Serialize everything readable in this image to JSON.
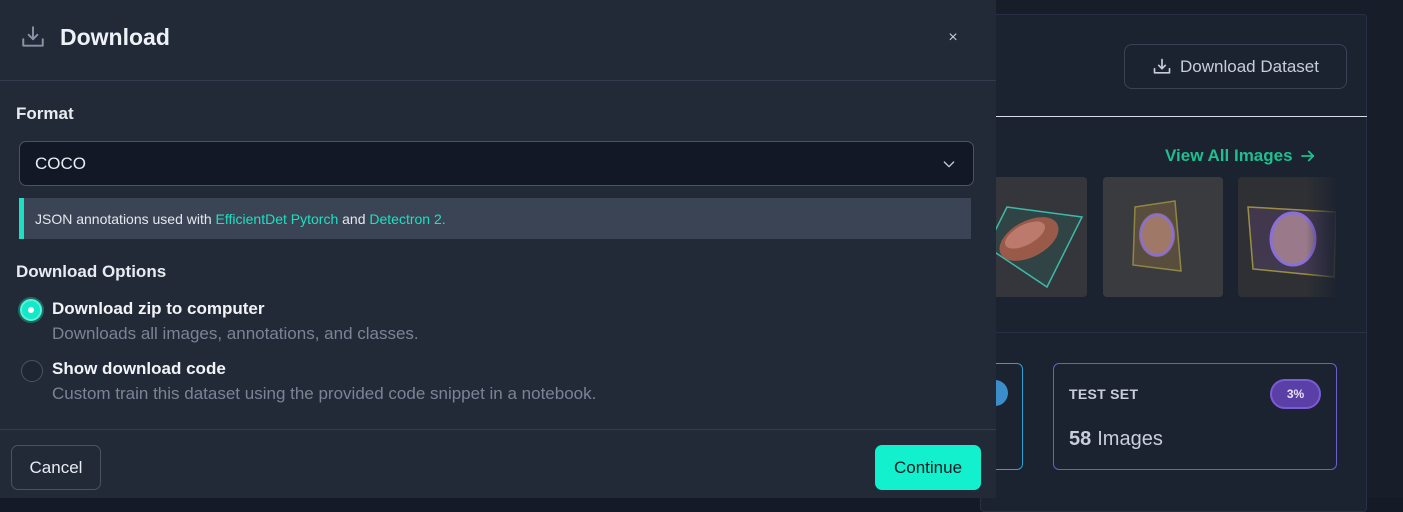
{
  "modal": {
    "title": "Download",
    "header_icon": "download-tray-icon",
    "close_label": "×",
    "format": {
      "label": "Format",
      "selected": "COCO",
      "note_prefix": "JSON annotations used with ",
      "note_link_1": "EfficientDet Pytorch",
      "note_middle": " and ",
      "note_link_2": "Detectron 2",
      "note_suffix": "."
    },
    "download_options": {
      "label": "Download Options",
      "options": [
        {
          "title": "Download zip to computer",
          "description": "Downloads all images, annotations, and classes.",
          "selected": true
        },
        {
          "title": "Show download code",
          "description": "Custom train this dataset using the provided code snippet in a notebook.",
          "selected": false
        }
      ]
    },
    "footer": {
      "cancel_label": "Cancel",
      "continue_label": "Continue"
    }
  },
  "background": {
    "download_dataset_label": "Download Dataset",
    "view_all_label": "View All Images",
    "test_set": {
      "title": "TEST SET",
      "percent": "3%",
      "count": "58",
      "count_unit": "Images"
    }
  },
  "colors": {
    "accent": "#12f0cd",
    "link": "#1de0c3",
    "view_all": "#1fbf8f",
    "test_set_border": "#6b5fc9",
    "modal_bg": "#222a38"
  }
}
